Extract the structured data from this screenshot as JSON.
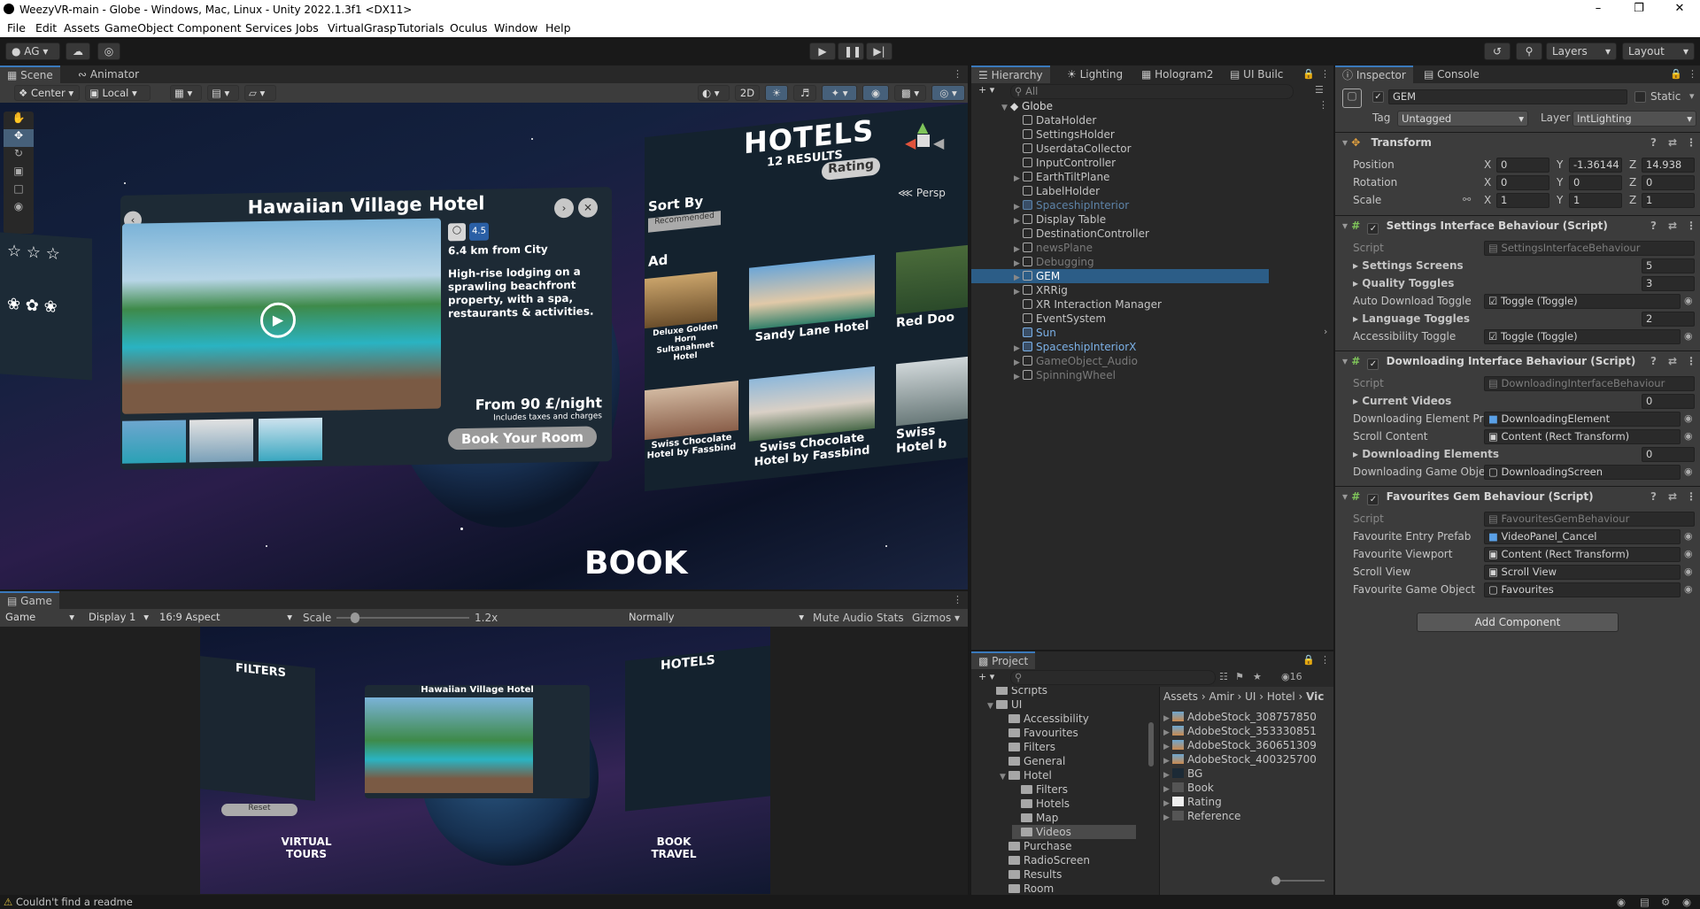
{
  "window": {
    "title": "WeezyVR-main - Globe - Windows, Mac, Linux - Unity 2022.1.3f1 <DX11>"
  },
  "menu": [
    "File",
    "Edit",
    "Assets",
    "GameObject",
    "Component",
    "Services",
    "Jobs",
    "VirtualGrasp",
    "Tutorials",
    "Oculus",
    "Window",
    "Help"
  ],
  "toolbar": {
    "account": "AG",
    "layers": "Layers",
    "layout": "Layout"
  },
  "scene_tabs": {
    "scene": "Scene",
    "animator": "Animator"
  },
  "scene_toolbar": {
    "pivot": "Center",
    "space": "Local",
    "mode2d": "2D",
    "persp": "Persp"
  },
  "scene_content": {
    "hotel_title": "Hawaiian Village Hotel",
    "distance": "6.4 km from City",
    "description": "High-rise lodging on a sprawling beachfront property, with a spa, restaurants & activities.",
    "price": "From 90 £/night",
    "price_note": "Includes taxes and charges",
    "book_btn": "Book Your Room",
    "hotels_title": "HOTELS",
    "hotels_count": "12 RESULTS",
    "sort_by": "Sort By",
    "recommended": "Recommended",
    "rating": "Rating",
    "ad": "Ad",
    "hotel_a": "Deluxe Golden Horn Sultanahmet Hotel",
    "hotel_b": "Sandy Lane Hotel",
    "hotel_c": "Red Doo",
    "hotel_d": "Swiss Chocolate Hotel by Fassbind",
    "hotel_e": "Swiss Chocolate Hotel by Fassbind",
    "hotel_f": "Swiss Hotel b",
    "book": "BOOK",
    "rating_badge": "4.5"
  },
  "game_tab": {
    "label": "Game",
    "display_mode": "Game",
    "display": "Display 1",
    "aspect": "16:9 Aspect",
    "scale_label": "Scale",
    "scale_value": "1.2x",
    "play_focus": "Normally",
    "mute": "Mute Audio",
    "stats": "Stats",
    "gizmos": "Gizmos"
  },
  "game_content": {
    "filters": "FILTERS",
    "hotel_title": "Hawaiian Village Hotel",
    "hotels": "HOTELS",
    "virtual_tours": "VIRTUAL TOURS",
    "book_travel": "BOOK TRAVEL",
    "reset": "Reset"
  },
  "hierarchy": {
    "tabs": [
      "Hierarchy",
      "Lighting",
      "Hologram2",
      "UI Builc"
    ],
    "search_placeholder": "All",
    "root": "Globe",
    "items": [
      {
        "label": "DataHolder",
        "state": "normal",
        "expandable": false
      },
      {
        "label": "SettingsHolder",
        "state": "normal",
        "expandable": false
      },
      {
        "label": "UserdataCollector",
        "state": "normal",
        "expandable": false
      },
      {
        "label": "InputController",
        "state": "normal",
        "expandable": false
      },
      {
        "label": "EarthTiltPlane",
        "state": "normal",
        "expandable": true
      },
      {
        "label": "LabelHolder",
        "state": "normal",
        "expandable": false
      },
      {
        "label": "SpaceshipInterior",
        "state": "prefab-dim",
        "expandable": true
      },
      {
        "label": "Display Table",
        "state": "normal",
        "expandable": true
      },
      {
        "label": "DestinationController",
        "state": "normal",
        "expandable": false
      },
      {
        "label": "newsPlane",
        "state": "disabled",
        "expandable": true
      },
      {
        "label": "Debugging",
        "state": "disabled",
        "expandable": true
      },
      {
        "label": "GEM",
        "state": "selected",
        "expandable": true
      },
      {
        "label": "XRRig",
        "state": "normal",
        "expandable": true
      },
      {
        "label": "XR Interaction Manager",
        "state": "normal",
        "expandable": false
      },
      {
        "label": "EventSystem",
        "state": "normal",
        "expandable": false
      },
      {
        "label": "Sun",
        "state": "prefab",
        "expandable": false
      },
      {
        "label": "SpaceshipInteriorX",
        "state": "prefab",
        "expandable": true
      },
      {
        "label": "GameObject_Audio",
        "state": "disabled",
        "expandable": true
      },
      {
        "label": "SpinningWheel",
        "state": "disabled",
        "expandable": true
      }
    ]
  },
  "inspector": {
    "tabs": [
      "Inspector",
      "Console"
    ],
    "object_name": "GEM",
    "static_label": "Static",
    "tag_label": "Tag",
    "tag": "Untagged",
    "layer_label": "Layer",
    "layer": "IntLighting",
    "transform": {
      "title": "Transform",
      "position": {
        "label": "Position",
        "x": "0",
        "y": "-1.36144",
        "z": "14.938"
      },
      "rotation": {
        "label": "Rotation",
        "x": "0",
        "y": "0",
        "z": "0"
      },
      "scale": {
        "label": "Scale",
        "x": "1",
        "y": "1",
        "z": "1"
      }
    },
    "settings": {
      "title": "Settings Interface Behaviour (Script)",
      "script_label": "Script",
      "script": "SettingsInterfaceBehaviour",
      "screens_label": "Settings Screens",
      "screens": "5",
      "quality_label": "Quality Toggles",
      "quality": "3",
      "auto_label": "Auto Download Toggle",
      "auto": "Toggle (Toggle)",
      "language_label": "Language Toggles",
      "language": "2",
      "access_label": "Accessibility Toggle",
      "access": "Toggle (Toggle)"
    },
    "downloading": {
      "title": "Downloading Interface Behaviour (Script)",
      "script_label": "Script",
      "script": "DownloadingInterfaceBehaviour",
      "videos_label": "Current Videos",
      "videos": "0",
      "element_label": "Downloading Element Pre",
      "element": "DownloadingElement",
      "scroll_label": "Scroll Content",
      "scroll": "Content (Rect Transform)",
      "elements_label": "Downloading Elements",
      "elements": "0",
      "go_label": "Downloading Game Objec",
      "go": "DownloadingScreen"
    },
    "favourites": {
      "title": "Favourites Gem Behaviour (Script)",
      "script_label": "Script",
      "script": "FavouritesGemBehaviour",
      "entry_label": "Favourite Entry Prefab",
      "entry": "VideoPanel_Cancel",
      "viewport_label": "Favourite Viewport",
      "viewport": "Content (Rect Transform)",
      "scrollview_label": "Scroll View",
      "scrollview": "Scroll View",
      "gameobj_label": "Favourite Game Object",
      "gameobj": "Favourites"
    },
    "add_component": "Add Component"
  },
  "project": {
    "tab": "Project",
    "count": "16",
    "tree": [
      {
        "label": "Scripts",
        "indent": 1
      },
      {
        "label": "UI",
        "indent": 1
      },
      {
        "label": "Accessibility",
        "indent": 2
      },
      {
        "label": "Favourites",
        "indent": 2
      },
      {
        "label": "Filters",
        "indent": 2
      },
      {
        "label": "General",
        "indent": 2
      },
      {
        "label": "Hotel",
        "indent": 2
      },
      {
        "label": "Filters",
        "indent": 3
      },
      {
        "label": "Hotels",
        "indent": 3
      },
      {
        "label": "Map",
        "indent": 3
      },
      {
        "label": "Videos",
        "indent": 3
      },
      {
        "label": "Purchase",
        "indent": 2
      },
      {
        "label": "RadioScreen",
        "indent": 2
      },
      {
        "label": "Results",
        "indent": 2
      },
      {
        "label": "Room",
        "indent": 2
      }
    ],
    "breadcrumb": [
      "Assets",
      "Amir",
      "UI",
      "Hotel",
      "Vic"
    ],
    "assets": [
      "AdobeStock_308757850",
      "AdobeStock_353330851",
      "AdobeStock_360651309",
      "AdobeStock_400325700",
      "BG",
      "Book",
      "Rating",
      "Reference"
    ]
  },
  "status": {
    "message": "Couldn't find a readme"
  },
  "colors": {
    "accent": "#3a79bb",
    "selection": "#2c5d87",
    "prefab": "#7bb0e6"
  }
}
